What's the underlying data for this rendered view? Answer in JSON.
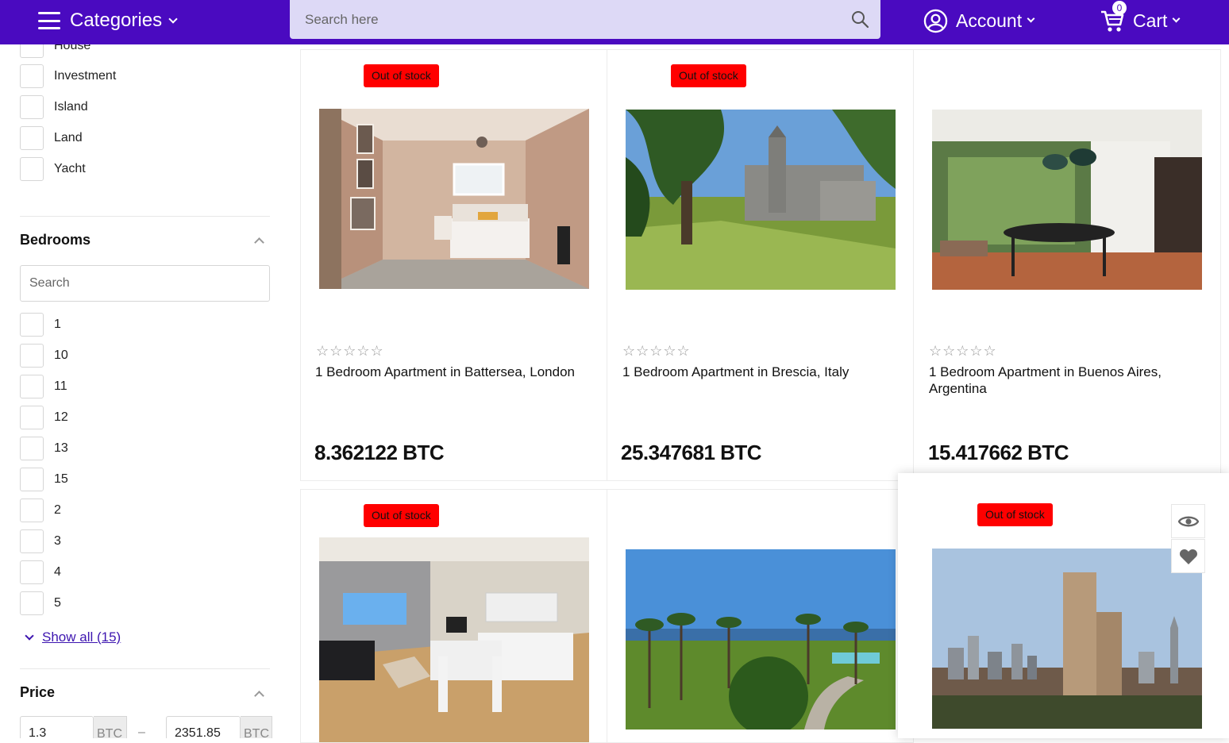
{
  "header": {
    "categories_label": "Categories",
    "search_placeholder": "Search here",
    "account_label": "Account",
    "cart_label": "Cart",
    "cart_count": "0"
  },
  "sidebar": {
    "type_items": [
      "House",
      "Investment",
      "Island",
      "Land",
      "Yacht"
    ],
    "bedrooms": {
      "title": "Bedrooms",
      "search_placeholder": "Search",
      "items": [
        "1",
        "10",
        "11",
        "12",
        "13",
        "15",
        "2",
        "3",
        "4",
        "5"
      ],
      "show_all": "Show all (15)"
    },
    "price": {
      "title": "Price",
      "min": "1.3",
      "max": "2351.85",
      "unit": "BTC",
      "separator": "–"
    }
  },
  "products": [
    {
      "badge": "Out of stock",
      "stars": "☆☆☆☆☆",
      "name": "1 Bedroom Apartment in Battersea, London",
      "price": "8.362122 BTC",
      "image": "bedroom"
    },
    {
      "badge": "Out of stock",
      "stars": "☆☆☆☆☆",
      "name": "1 Bedroom Apartment in Brescia, Italy",
      "price": "25.347681 BTC",
      "image": "castle"
    },
    {
      "badge": "",
      "stars": "☆☆☆☆☆",
      "name": "1 Bedroom Apartment in Buenos Aires, Argentina",
      "price": "15.417662 BTC",
      "image": "dining"
    },
    {
      "badge": "Out of stock",
      "image": "living-room"
    },
    {
      "badge": "",
      "image": "palm-garden"
    },
    {
      "badge": "Out of stock",
      "image": "city-tower"
    }
  ],
  "icons": {
    "menu": "hamburger-icon",
    "search": "search-icon",
    "account": "user-circle-icon",
    "cart": "cart-icon",
    "quick_view": "eye-icon",
    "wishlist": "heart-icon"
  },
  "colors": {
    "header_bg": "#4a0ac0",
    "search_bg": "#ddd9f6",
    "badge_bg": "#ff0000",
    "link": "#3d15b0"
  }
}
